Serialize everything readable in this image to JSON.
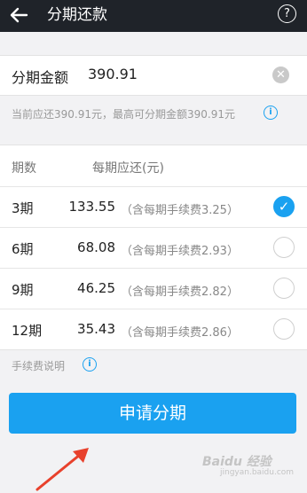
{
  "header": {
    "title": "分期还款",
    "help_icon": "?"
  },
  "amount": {
    "label": "分期金额",
    "value": "390.91"
  },
  "hint": "当前应还390.91元，最高可分期金额390.91元",
  "table": {
    "headers": [
      "期数",
      "每期应还(元)"
    ],
    "rows": [
      {
        "period": "3期",
        "pay": "133.55",
        "fee": "（含每期手续费3.25）",
        "selected": true
      },
      {
        "period": "6期",
        "pay": "68.08",
        "fee": "（含每期手续费2.93）",
        "selected": false
      },
      {
        "period": "9期",
        "pay": "46.25",
        "fee": "（含每期手续费2.82）",
        "selected": false
      },
      {
        "period": "12期",
        "pay": "35.43",
        "fee": "（含每期手续费2.86）",
        "selected": false
      }
    ]
  },
  "fee_note": "手续费说明",
  "apply_button": "申请分期",
  "watermark": {
    "main": "Baidu 经验",
    "sub": "jingyan.baidu.com"
  },
  "colors": {
    "accent": "#1aa1f0",
    "topbar": "#1f2329",
    "annotation": "#e8412c"
  }
}
